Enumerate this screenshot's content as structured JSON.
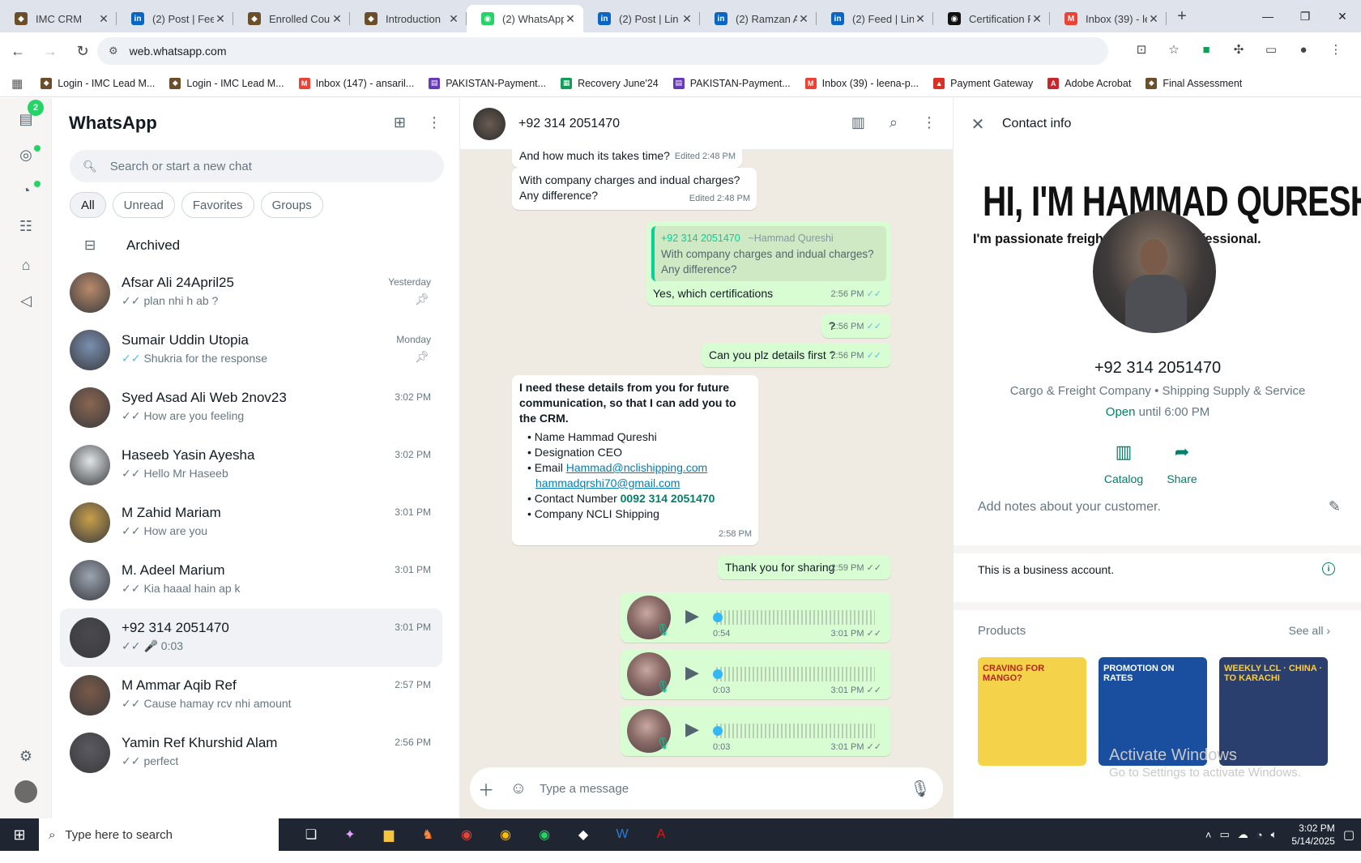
{
  "browser": {
    "tabs": [
      {
        "title": "IMC CRM",
        "color": "#6b4f2a",
        "glyph": "◆"
      },
      {
        "title": "(2) Post | Feed",
        "color": "#0a66c2",
        "glyph": "in"
      },
      {
        "title": "Enrolled Cour",
        "color": "#6b4f2a",
        "glyph": "◆"
      },
      {
        "title": "Introduction",
        "color": "#6b4f2a",
        "glyph": "◆"
      },
      {
        "title": "(2) WhatsApp",
        "color": "#25d366",
        "glyph": "◉",
        "active": true
      },
      {
        "title": "(2) Post | Lin",
        "color": "#0a66c2",
        "glyph": "in"
      },
      {
        "title": "(2) Ramzan Al",
        "color": "#0a66c2",
        "glyph": "in"
      },
      {
        "title": "(2) Feed | Link",
        "color": "#0a66c2",
        "glyph": "in"
      },
      {
        "title": "Certification F",
        "color": "#111111",
        "glyph": "◉"
      },
      {
        "title": "Inbox (39) - le",
        "color": "#ea4335",
        "glyph": "M"
      }
    ],
    "url": "web.whatsapp.com",
    "bookmarks": [
      {
        "label": "Login - IMC Lead M...",
        "color": "#6b4f2a",
        "glyph": "◆"
      },
      {
        "label": "Login - IMC Lead M...",
        "color": "#6b4f2a",
        "glyph": "◆"
      },
      {
        "label": "Inbox (147) - ansaril...",
        "color": "#ea4335",
        "glyph": "M"
      },
      {
        "label": "PAKISTAN-Payment...",
        "color": "#673ab7",
        "glyph": "▤"
      },
      {
        "label": "Recovery June'24",
        "color": "#0f9d58",
        "glyph": "▦"
      },
      {
        "label": "PAKISTAN-Payment...",
        "color": "#673ab7",
        "glyph": "▤"
      },
      {
        "label": "Inbox (39) - leena-p...",
        "color": "#ea4335",
        "glyph": "M"
      },
      {
        "label": "Payment Gateway",
        "color": "#d93025",
        "glyph": "▲"
      },
      {
        "label": "Adobe Acrobat",
        "color": "#c9252c",
        "glyph": "A"
      },
      {
        "label": "Final Assessment",
        "color": "#6b4f2a",
        "glyph": "◆"
      }
    ]
  },
  "rail": {
    "badge_count": "2"
  },
  "chat_list": {
    "title": "WhatsApp",
    "search_placeholder": "Search or start a new chat",
    "filters": [
      "All",
      "Unread",
      "Favorites",
      "Groups"
    ],
    "archived_label": "Archived",
    "chats": [
      {
        "name": "Afsar Ali 24April25",
        "message": "plan nhi h ab ?",
        "time": "Yesterday",
        "pinned": true,
        "tick": "grey",
        "avatar": "#b98a6a"
      },
      {
        "name": "Sumair Uddin Utopia",
        "message": "Shukria for the response",
        "time": "Monday",
        "pinned": true,
        "tick": "blue",
        "avatar": "#7a8fb0"
      },
      {
        "name": "Syed Asad Ali Web 2nov23",
        "message": "How are you feeling",
        "time": "3:02 PM",
        "tick": "grey",
        "avatar": "#8a6650"
      },
      {
        "name": "Haseeb Yasin Ayesha",
        "message": "Hello Mr Haseeb",
        "time": "3:02 PM",
        "tick": "grey",
        "avatar": "#dfe5e7"
      },
      {
        "name": "M Zahid Mariam",
        "message": "How are you",
        "time": "3:01 PM",
        "tick": "grey",
        "avatar": "#c9a04a"
      },
      {
        "name": "M. Adeel Marium",
        "message": "Kia haaal hain ap k",
        "time": "3:01 PM",
        "tick": "grey",
        "avatar": "#9aa4b0"
      },
      {
        "name": "+92 314 2051470",
        "message": "🎤 0:03",
        "time": "3:01 PM",
        "tick": "grey",
        "selected": true,
        "avatar": "#4a4a4e"
      },
      {
        "name": "M Ammar Aqib Ref",
        "message": "Cause hamay rcv nhi amount",
        "time": "2:57 PM",
        "tick": "grey",
        "avatar": "#7a5a48"
      },
      {
        "name": "Yamin Ref Khurshid Alam",
        "message": "perfect",
        "time": "2:56 PM",
        "tick": "grey",
        "avatar": "#5a5a60"
      }
    ]
  },
  "conversation": {
    "contact": "+92 314 2051470",
    "messages": {
      "m1_text": "And how much its takes time?",
      "m1_meta": "Edited 2:48 PM",
      "m2_text_a": "With company charges and indual charges?",
      "m2_text_b": "Any difference?",
      "m2_meta": "Edited 2:48 PM",
      "m3_quote_name": "+92 314 2051470",
      "m3_quote_alias": "~Hammad Qureshi",
      "m3_quote_text_a": "With company charges and indual charges?",
      "m3_quote_text_b": "Any difference?",
      "m3_text": "Yes, which certifications",
      "m3_meta": "2:56 PM",
      "m4_text": "?",
      "m4_meta": "2:56 PM",
      "m5_text": "Can you plz details first ?",
      "m5_meta": "2:56 PM",
      "m6_heading": "I need these details from you for future communication, so that I can add you to the CRM.",
      "m6_name": "Name Hammad Qureshi",
      "m6_designation": "Designation CEO",
      "m6_email_label": "Email",
      "m6_email1": "Hammad@nclishipping.com",
      "m6_email2": "hammadqrshi70@gmail.com",
      "m6_contact_label": "Contact Number",
      "m6_contact_value": "0092 314 2051470",
      "m6_company": "Company NCLI Shipping",
      "m6_meta": "2:58 PM",
      "m7_text": "Thank you for sharing",
      "m7_meta": "2:59 PM"
    },
    "voice_notes": [
      {
        "duration": "0:54",
        "time": "3:01 PM"
      },
      {
        "duration": "0:03",
        "time": "3:01 PM"
      },
      {
        "duration": "0:03",
        "time": "3:01 PM"
      }
    ],
    "compose_placeholder": "Type a message"
  },
  "contact_info": {
    "title": "Contact info",
    "cover_title": "HI, I'M HAMMAD QURESHI",
    "cover_subtitle": "I'm passionate freight                 pply chain professional.",
    "number": "+92 314 2051470",
    "category": "Cargo & Freight Company • Shipping Supply & Service",
    "open_label": "Open",
    "open_until": "until 6:00 PM",
    "catalog_label": "Catalog",
    "share_label": "Share",
    "notes_placeholder": "Add notes about your customer.",
    "business_note": "This is a business account.",
    "products_label": "Products",
    "see_all": "See all",
    "products": [
      {
        "caption": "CRAVING FOR MANGO?",
        "bg": "#f4d24a",
        "fg": "#b3261e"
      },
      {
        "caption": "PROMOTION ON RATES",
        "bg": "#1a4fa0",
        "fg": "#ffffff"
      },
      {
        "caption": "WEEKLY LCL · CHINA · TO KARACHI",
        "bg": "#2a3f6e",
        "fg": "#ffcc33"
      }
    ],
    "watermark_line1": "Activate Windows",
    "watermark_line2": "Go to Settings to activate Windows."
  },
  "taskbar": {
    "search_placeholder": "Type here to search",
    "time": "3:02 PM",
    "date": "5/14/2025"
  }
}
